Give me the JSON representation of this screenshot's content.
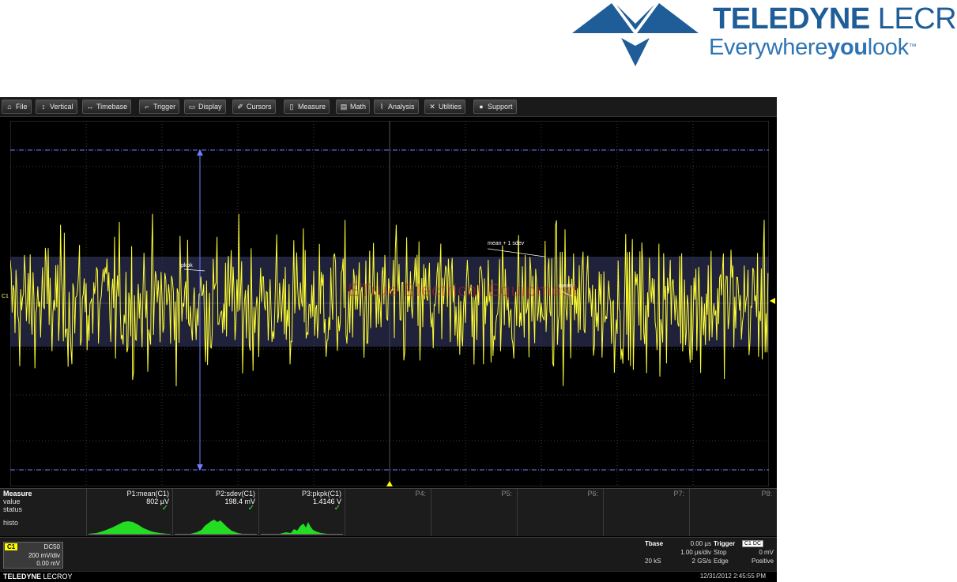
{
  "logo": {
    "brand_bold": "TELEDYNE",
    "brand_light": " LECROY",
    "tagline_pre": "Everywhere",
    "tagline_bold": "you",
    "tagline_post": "look",
    "tagline_tm": "™",
    "color": "#1f5d98"
  },
  "menu": [
    {
      "label": "File",
      "icon": "file-icon"
    },
    {
      "label": "Vertical",
      "icon": "vertical-arrows-icon"
    },
    {
      "label": "Timebase",
      "icon": "horizontal-arrows-icon"
    },
    {
      "label": "Trigger",
      "icon": "trigger-icon"
    },
    {
      "label": "Display",
      "icon": "display-icon"
    },
    {
      "label": "Cursors",
      "icon": "cursor-icon"
    },
    {
      "label": "Measure",
      "icon": "measure-icon"
    },
    {
      "label": "Math",
      "icon": "math-icon"
    },
    {
      "label": "Analysis",
      "icon": "analysis-icon"
    },
    {
      "label": "Utilities",
      "icon": "utilities-icon"
    },
    {
      "label": "Support",
      "icon": "info-icon"
    }
  ],
  "display": {
    "channel_marker": "C1",
    "annotation_pkpk": "pkpk",
    "annotation_mean_sdev": "mean + 1 sdev",
    "annotation_mean": "mean",
    "watermark": "ETrue Electrical Equipment",
    "trace_color": "#ffff33",
    "cursor_color": "#6f7fff"
  },
  "measure": {
    "title": "Measure",
    "row_value": "value",
    "row_status": "status",
    "row_histo": "histo",
    "params": [
      {
        "name": "P1:mean(C1)",
        "value": "802 µV",
        "status": "✓"
      },
      {
        "name": "P2:sdev(C1)",
        "value": "198.4 mV",
        "status": "✓"
      },
      {
        "name": "P3:pkpk(C1)",
        "value": "1.4146 V",
        "status": "✓"
      }
    ],
    "empty_params": [
      "P4:",
      "P5:",
      "P6:",
      "P7:",
      "P8:"
    ]
  },
  "channel": {
    "tag": "C1",
    "coupling": "DC50",
    "scale": "200 mV/div",
    "offset": "0.00 mV"
  },
  "timebase": {
    "title": "Tbase",
    "delay": "0.00 µs",
    "tdiv": "1.00 µs/div",
    "samples": "20 kS",
    "rate": "2 GS/s"
  },
  "trigger": {
    "title": "Trigger",
    "badge": "C1 DC",
    "mode": "Stop",
    "level": "0 mV",
    "type": "Edge",
    "slope": "Positive"
  },
  "status": {
    "brand_bold": "TELEDYNE",
    "brand_light": " LECROY",
    "datetime": "12/31/2012 2:45:55 PM"
  }
}
